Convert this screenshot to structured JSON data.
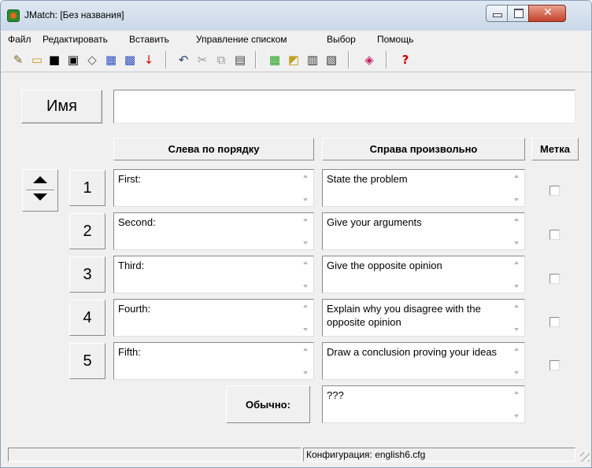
{
  "window": {
    "title": "JMatch: [Без названия]"
  },
  "menu": [
    "Файл",
    "Редактировать",
    "Вставить",
    "Управление списком",
    "Выбор",
    "Помощь"
  ],
  "toolbar": {
    "icons": [
      "new-file-icon",
      "open-folder-icon",
      "save-icon",
      "save-as-icon",
      "eraser-icon",
      "web-page-icon",
      "web-page-alt-icon",
      "arrow-down-red-icon",
      "undo-icon",
      "cut-icon",
      "copy-icon",
      "paste-icon",
      "config-icon",
      "export-icon",
      "grid-icon",
      "grid-alt-icon",
      "palette-icon",
      "help-icon"
    ]
  },
  "name_label": "Имя",
  "name_value": "",
  "headers": {
    "left": "Слева по порядку",
    "right": "Справа произвольно",
    "tag": "Метка"
  },
  "rows": [
    {
      "num": "1",
      "left": "First:",
      "right": "State the problem",
      "checked": false
    },
    {
      "num": "2",
      "left": "Second:",
      "right": "Give your arguments",
      "checked": false
    },
    {
      "num": "3",
      "left": "Third:",
      "right": "Give the opposite opinion",
      "checked": false
    },
    {
      "num": "4",
      "left": "Fourth:",
      "right": "Explain why you disagree with the opposite opinion",
      "checked": false
    },
    {
      "num": "5",
      "left": "Fifth:",
      "right": "Draw a conclusion proving your ideas",
      "checked": false
    }
  ],
  "default_label": "Обычно:",
  "default_value": "???",
  "status": {
    "left": "",
    "right": "Конфигурация: english6.cfg"
  }
}
